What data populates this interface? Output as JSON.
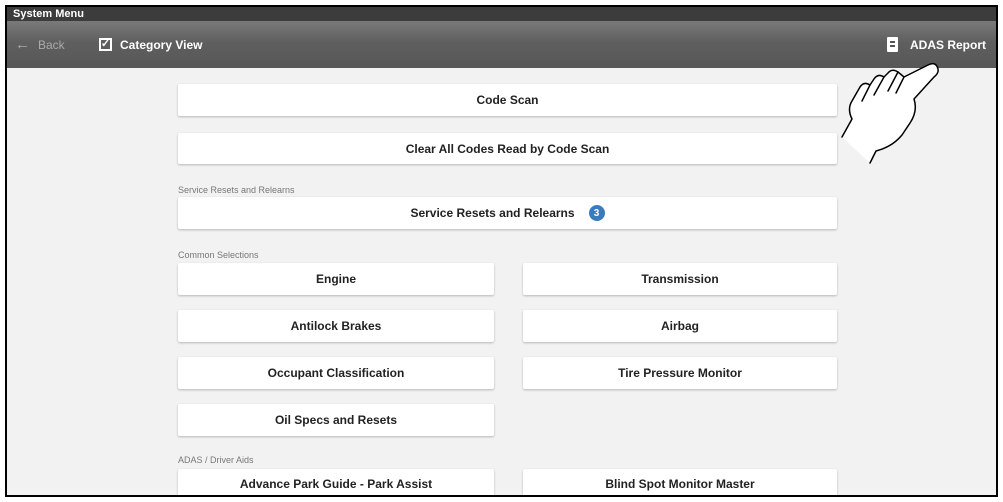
{
  "window": {
    "title": "System Menu"
  },
  "toolbar": {
    "back_label": "Back",
    "category_view_label": "Category View",
    "category_view_checked": true,
    "adas_report_label": "ADAS Report"
  },
  "main": {
    "code_scan_label": "Code Scan",
    "clear_codes_label": "Clear All Codes Read by Code Scan",
    "service_section": {
      "title": "Service Resets and Relearns",
      "button_label": "Service Resets and Relearns",
      "badge_count": "3"
    },
    "common_section": {
      "title": "Common Selections",
      "items": [
        "Engine",
        "Transmission",
        "Antilock Brakes",
        "Airbag",
        "Occupant Classification",
        "Tire Pressure Monitor",
        "Oil Specs and Resets"
      ]
    },
    "adas_section": {
      "title": "ADAS / Driver Aids",
      "items": [
        "Advance Park Guide - Park Assist",
        "Blind Spot Monitor Master"
      ]
    }
  },
  "icons": {
    "back": "back-arrow-icon",
    "checkbox": "checkbox-checked-icon",
    "report": "report-document-icon",
    "badge_color": "#3a7bbf"
  }
}
